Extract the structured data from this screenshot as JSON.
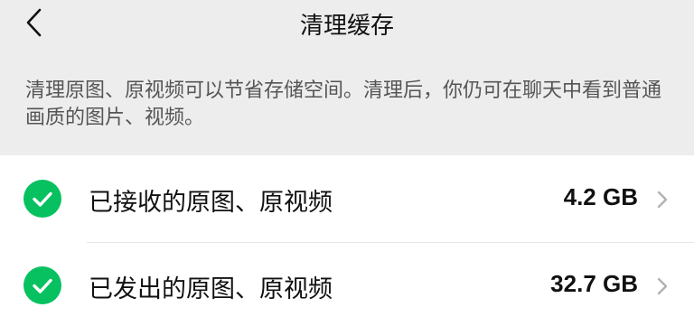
{
  "header": {
    "title": "清理缓存",
    "back_icon": "chevron-left-icon"
  },
  "description": "清理原图、原视频可以节省存储空间。清理后，你仍可在聊天中看到普通画质的图片、视频。",
  "items": [
    {
      "label": "已接收的原图、原视频",
      "size": "4.2 GB",
      "checked": true
    },
    {
      "label": "已发出的原图、原视频",
      "size": "32.7 GB",
      "checked": true
    }
  ],
  "colors": {
    "accent": "#07c160",
    "background": "#ededed",
    "surface": "#ffffff"
  }
}
